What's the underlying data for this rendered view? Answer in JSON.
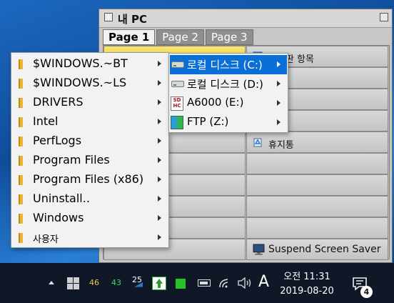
{
  "window": {
    "title": "내 PC",
    "tabs": [
      "Page 1",
      "Page 2",
      "Page 3"
    ]
  },
  "grid": {
    "right_cells": [
      "제어판 항목",
      "",
      "",
      "",
      "휴지통",
      "",
      "",
      "",
      "",
      "Suspend Screen Saver"
    ]
  },
  "folder_menu": {
    "items": [
      "$WINDOWS.~BT",
      "$WINDOWS.~LS",
      "DRIVERS",
      "Intel",
      "PerfLogs",
      "Program Files",
      "Program Files (x86)",
      "Uninstall..",
      "Windows",
      "사용자"
    ]
  },
  "drive_menu": {
    "items": [
      {
        "label": "로컬 디스크 (C:)",
        "icon": "hard-drive-icon",
        "highlighted": true
      },
      {
        "label": "로컬 디스크 (D:)",
        "icon": "hard-drive-icon",
        "highlighted": false
      },
      {
        "label": "A6000 (E:)",
        "icon": "sd-card-icon",
        "highlighted": false
      },
      {
        "label": "FTP (Z:)",
        "icon": "ftp-icon",
        "highlighted": false
      }
    ],
    "sd_icon_text": [
      "SD",
      "HC"
    ]
  },
  "taskbar": {
    "tray_numbers": [
      {
        "value": "46",
        "color": "#e8c84a"
      },
      {
        "value": "43",
        "color": "#3fd46a"
      },
      {
        "value": "25",
        "color": "#ffffff"
      }
    ],
    "ime_label": "A",
    "time": "오전 11:31",
    "date": "2019-08-20",
    "notification_count": "4"
  },
  "colors": {
    "highlight": "#0a6fd6",
    "active_cell": "#f7e26a",
    "taskbar": "#101828"
  }
}
